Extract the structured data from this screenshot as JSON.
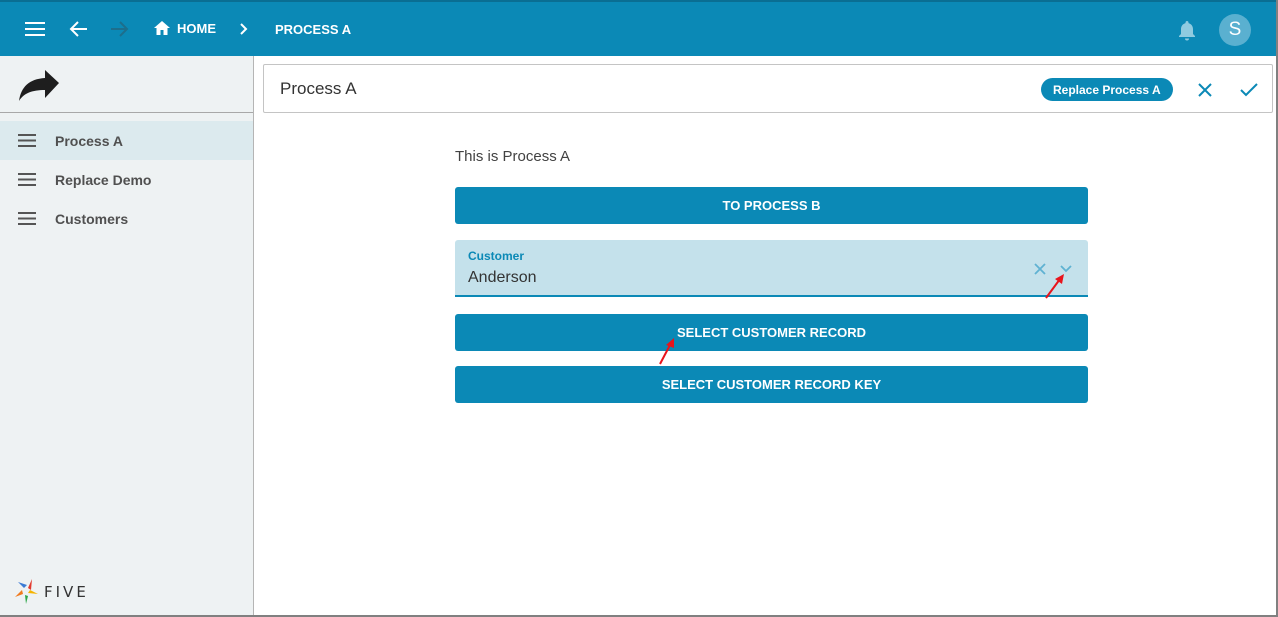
{
  "topbar": {
    "menu_icon": "hamburger-menu-icon",
    "back_icon": "arrow-left-icon",
    "forward_icon": "arrow-right-icon",
    "home_label": "HOME",
    "home_icon": "home-icon",
    "separator_icon": "chevron-right-icon",
    "current_label": "PROCESS A",
    "bell_icon": "bell-icon",
    "avatar_initial": "S"
  },
  "sidebar": {
    "logo_icon": "share-arrow-icon",
    "items": [
      {
        "label": "Process A",
        "active": true
      },
      {
        "label": "Replace Demo",
        "active": false
      },
      {
        "label": "Customers",
        "active": false
      }
    ],
    "brand": "FIVE"
  },
  "form": {
    "title": "Process A",
    "chip_label": "Replace Process A",
    "cancel_icon": "close-icon",
    "confirm_icon": "check-icon"
  },
  "content": {
    "intro": "This is Process A",
    "to_process_b": "TO PROCESS B",
    "customer_field": {
      "label": "Customer",
      "value": "Anderson"
    },
    "select_record": "SELECT CUSTOMER RECORD",
    "select_record_key": "SELECT CUSTOMER RECORD KEY"
  },
  "colors": {
    "primary": "#0b89b6",
    "sidebar_bg": "#eef2f3",
    "field_bg": "#c4e1eb",
    "annotation_arrow": "#e8141c"
  }
}
